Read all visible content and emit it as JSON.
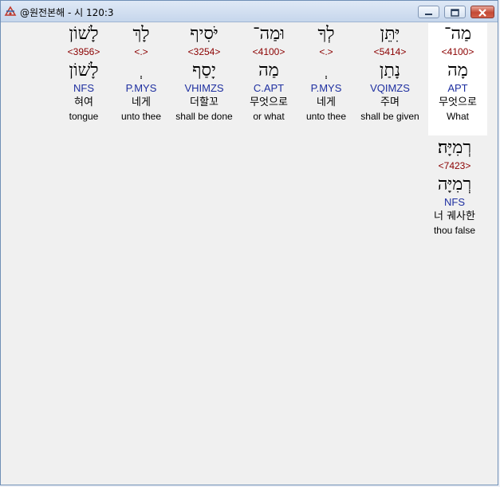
{
  "window": {
    "title": "@원전본해 - 시 120:3"
  },
  "words_row1": [
    {
      "hebrew": "מַה־",
      "strong": "<4100>",
      "lemma": "מָה",
      "parse": "APT",
      "korean": "무엇으로",
      "english": "What"
    },
    {
      "hebrew": "יִּתֵּן",
      "strong": "<5414>",
      "lemma": "נָתַן",
      "parse": "VQIMZS",
      "korean": "주며",
      "english": "shall be given"
    },
    {
      "hebrew": "לְךָ",
      "strong": "<.>",
      "lemma": "ְ",
      "parse": "P.MYS",
      "korean": "네게",
      "english": "unto thee"
    },
    {
      "hebrew": "וּמַה־",
      "strong": "<4100>",
      "lemma": "מַה",
      "parse": "C.APT",
      "korean": "무엇으로",
      "english": "or what"
    },
    {
      "hebrew": "יֹּסִיף",
      "strong": "<3254>",
      "lemma": "יָסַף",
      "parse": "VHIMZS",
      "korean": "더할꼬",
      "english": "shall be done"
    },
    {
      "hebrew": "לָךְ",
      "strong": "<.>",
      "lemma": "ְ",
      "parse": "P.MYS",
      "korean": "네게",
      "english": "unto thee"
    },
    {
      "hebrew": "לָשׁוֹן",
      "strong": "<3956>",
      "lemma": "לָשׁוֹן",
      "parse": "NFS",
      "korean": "혀여",
      "english": "tongue"
    }
  ],
  "words_row2": [
    {
      "hebrew": "רְמִיָּה׃",
      "strong": "<7423>",
      "lemma": "רְמִיָּה",
      "parse": "NFS",
      "korean": "너 궤사한",
      "english": "thou false"
    }
  ]
}
